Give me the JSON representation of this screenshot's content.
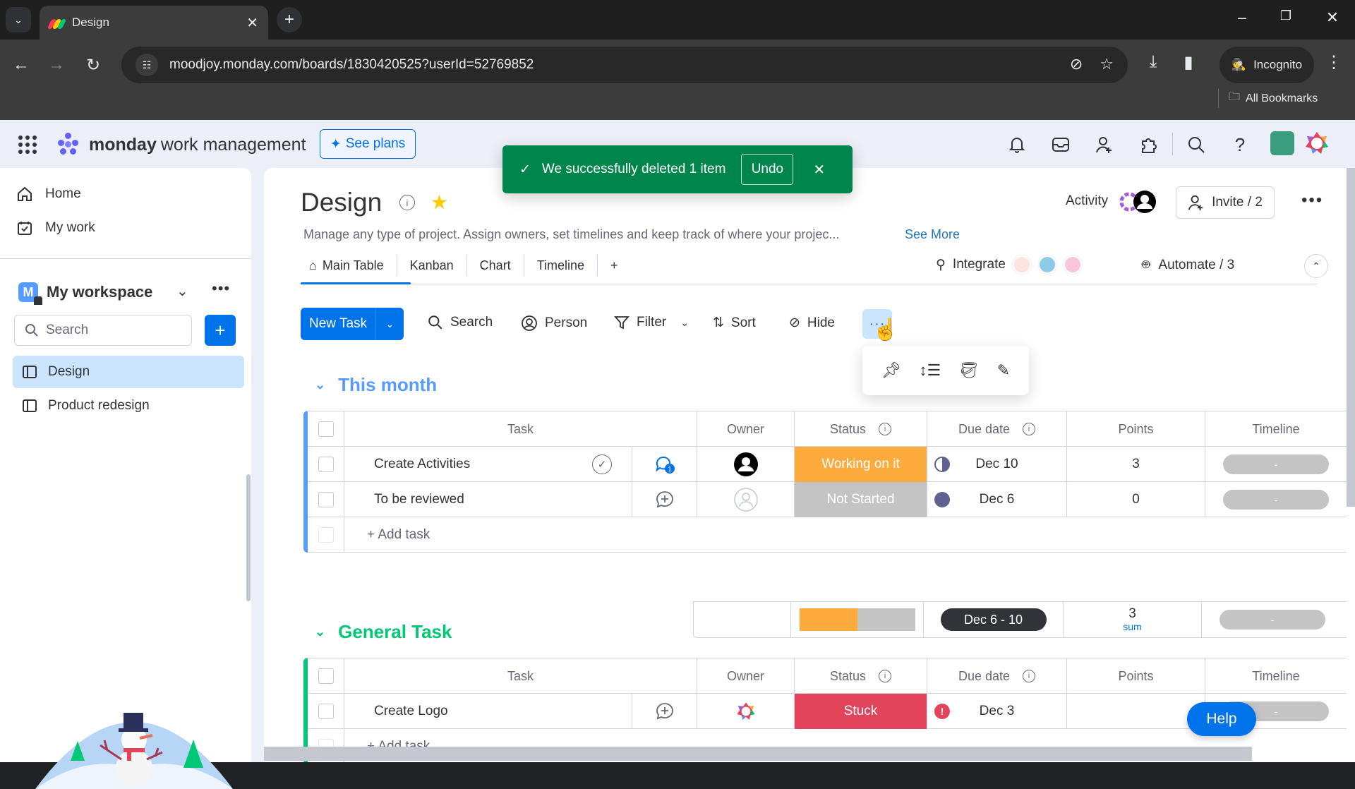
{
  "browser": {
    "tab_title": "Design",
    "url": "moodjoy.monday.com/boards/1830420525?userId=52769852",
    "incognito_label": "Incognito",
    "bookmarks_label": "All Bookmarks"
  },
  "topnav": {
    "brand": "monday",
    "brand_suffix": "work management",
    "see_plans": "See plans"
  },
  "toast": {
    "message": "We successfully deleted 1 item",
    "undo": "Undo"
  },
  "sidebar": {
    "home": "Home",
    "my_work": "My work",
    "workspace_initial": "M",
    "workspace_name": "My workspace",
    "search_placeholder": "Search",
    "boards": [
      {
        "label": "Design",
        "active": true
      },
      {
        "label": "Product redesign",
        "active": false
      }
    ]
  },
  "board": {
    "title": "Design",
    "description": "Manage any type of project. Assign owners, set timelines and keep track of where your projec...",
    "see_more": "See More",
    "activity": "Activity",
    "invite": "Invite / 2",
    "views": [
      "Main Table",
      "Kanban",
      "Chart",
      "Timeline",
      "+"
    ],
    "integrate": "Integrate",
    "automate": "Automate / 3"
  },
  "toolbar": {
    "new_task": "New Task",
    "search": "Search",
    "person": "Person",
    "filter": "Filter",
    "sort": "Sort",
    "hide": "Hide",
    "more": "···"
  },
  "columns": {
    "task": "Task",
    "owner": "Owner",
    "status": "Status",
    "due": "Due date",
    "points": "Points",
    "timeline": "Timeline"
  },
  "groups": [
    {
      "name": "This month",
      "color": "#579bfc",
      "rows": [
        {
          "task": "Create Activities",
          "status": "Working on it",
          "status_color": "#fdab3d",
          "due": "Dec 10",
          "points": "3",
          "timeline": "-"
        },
        {
          "task": "To be reviewed",
          "status": "Not Started",
          "status_color": "#c4c4c4",
          "due": "Dec 6",
          "points": "0",
          "timeline": "-"
        }
      ],
      "add_task": "+ Add task",
      "summary": {
        "due_range": "Dec 6 - 10",
        "points_sum": "3",
        "points_label": "sum",
        "timeline": "-",
        "status_split": {
          "working_on_it": 0.5,
          "not_started": 0.5
        }
      }
    },
    {
      "name": "General Task",
      "color": "#00c875",
      "rows": [
        {
          "task": "Create Logo",
          "status": "Stuck",
          "status_color": "#e2445c",
          "due": "Dec 3",
          "points": "",
          "timeline": "-"
        }
      ],
      "add_task": "+ Add task"
    }
  ],
  "help": "Help"
}
